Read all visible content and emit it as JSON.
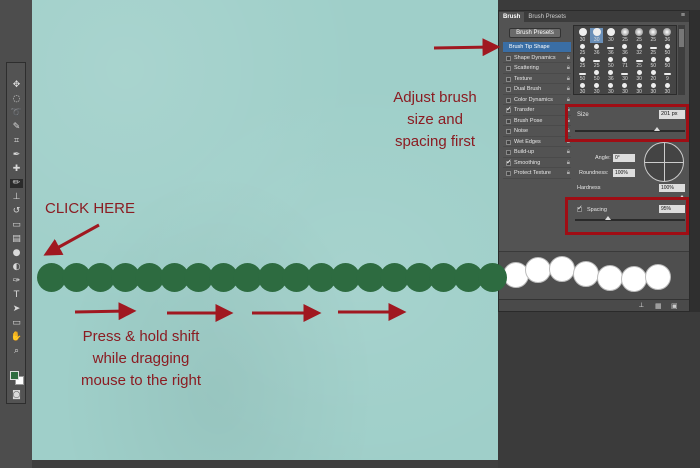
{
  "panel": {
    "tabs": [
      "Brush",
      "Brush Presets"
    ],
    "presets_button": "Brush Presets",
    "options": [
      {
        "label": "Brush Tip Shape",
        "checked": null,
        "active": true
      },
      {
        "label": "Shape Dynamics",
        "checked": false
      },
      {
        "label": "Scattering",
        "checked": false
      },
      {
        "label": "Texture",
        "checked": false
      },
      {
        "label": "Dual Brush",
        "checked": false
      },
      {
        "label": "Color Dynamics",
        "checked": false
      },
      {
        "label": "Transfer",
        "checked": true
      },
      {
        "label": "Brush Pose",
        "checked": false
      },
      {
        "label": "Noise",
        "checked": false
      },
      {
        "label": "Wet Edges",
        "checked": false
      },
      {
        "label": "Build-up",
        "checked": false
      },
      {
        "label": "Smoothing",
        "checked": true
      },
      {
        "label": "Protect Texture",
        "checked": false
      }
    ],
    "tip_sizes": [
      "30",
      "30",
      "30",
      "25",
      "25",
      "25",
      "36",
      "25",
      "36",
      "36",
      "36",
      "32",
      "25",
      "50",
      "25",
      "25",
      "50",
      "71",
      "25",
      "50",
      "50",
      "50",
      "50",
      "36",
      "30",
      "30",
      "20",
      "9",
      "30",
      "30",
      "30",
      "30",
      "30",
      "30",
      "30"
    ],
    "size_label": "Size",
    "size_value": "201 px",
    "angle_label": "Angle:",
    "angle_value": "0°",
    "roundness_label": "Roundness:",
    "roundness_value": "100%",
    "hardness_label": "Hardness",
    "hardness_value": "100%",
    "spacing_label": "Spacing",
    "spacing_value": "95%",
    "spacing_checked": true
  },
  "annotations": {
    "adjust": [
      "Adjust brush",
      "size and",
      "spacing first"
    ],
    "click_here": "CLICK HERE",
    "press_hold": [
      "Press & hold shift",
      "while dragging",
      "mouse to the right"
    ]
  },
  "colors": {
    "annotation_red": "#8b1c22",
    "highlight_red": "#a00d14",
    "dot_green": "#2d6b40",
    "canvas_teal": "#9fcfc9",
    "foreground_swatch": "#2f6b3f"
  }
}
